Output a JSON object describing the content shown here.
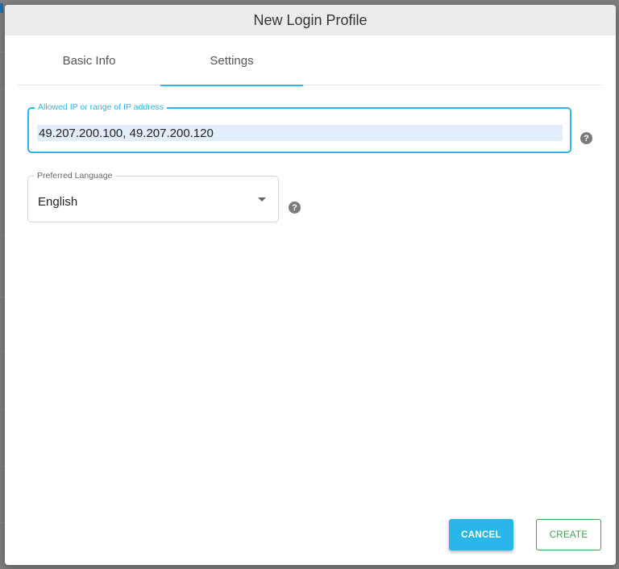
{
  "dialog": {
    "title": "New Login Profile"
  },
  "tabs": [
    {
      "label": "Basic Info",
      "active": false
    },
    {
      "label": "Settings",
      "active": true
    }
  ],
  "fields": {
    "allowed_ip": {
      "label": "Allowed IP or range of IP address",
      "value": "49.207.200.100, 49.207.200.120"
    },
    "preferred_language": {
      "label": "Preferred Language",
      "value": "English"
    }
  },
  "icons": {
    "help": "?"
  },
  "buttons": {
    "cancel": "CANCEL",
    "create": "CREATE"
  },
  "colors": {
    "accent": "#29b6e8",
    "create": "#3aa64c",
    "header_bg": "#ececec"
  }
}
